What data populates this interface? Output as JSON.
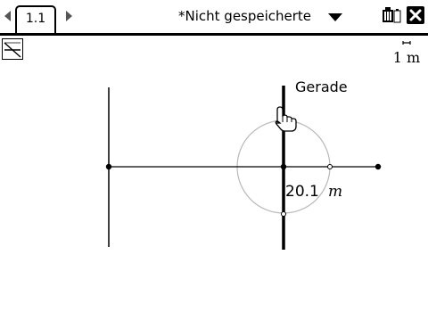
{
  "header": {
    "page_tab_label": "1.1",
    "document_title": "*Nicht gespeicherte"
  },
  "workspace": {
    "scale_label": "1 m",
    "line_label": "Gerade",
    "measurement": {
      "value": "20.1",
      "unit": "m"
    }
  },
  "icons": {
    "nav_left": "chevron-left-icon",
    "nav_right": "chevron-right-icon",
    "menu": "caret-down-icon",
    "battery": "battery-icon",
    "close": "close-icon",
    "tool": "geometry-tool-icon",
    "cursor": "hand-pointer-icon"
  }
}
